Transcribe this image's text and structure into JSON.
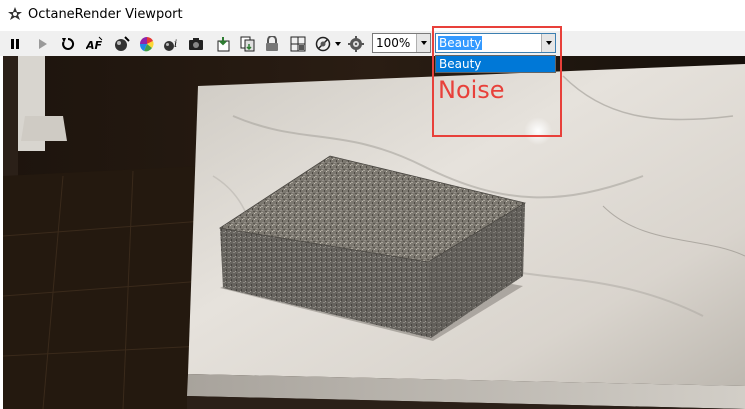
{
  "window": {
    "title": "OctaneRender Viewport"
  },
  "toolbar": {
    "buttons": [
      {
        "name": "pause-button",
        "icon": "pause-icon"
      },
      {
        "name": "play-button",
        "icon": "play-icon"
      },
      {
        "name": "restart-button",
        "icon": "restart-icon"
      },
      {
        "name": "auto-focus-button",
        "icon": "af-icon"
      },
      {
        "name": "pick-material-button",
        "icon": "material-pick-icon"
      },
      {
        "name": "color-picker-button",
        "icon": "color-wheel-icon"
      },
      {
        "name": "info-button",
        "icon": "info-icon"
      },
      {
        "name": "camera-button",
        "icon": "camera-icon"
      },
      {
        "name": "save-render-button",
        "icon": "save-icon"
      },
      {
        "name": "copy-render-button",
        "icon": "copy-icon"
      },
      {
        "name": "lock-button",
        "icon": "lock-icon"
      },
      {
        "name": "region-button",
        "icon": "region-icon"
      },
      {
        "name": "clay-mode-button",
        "icon": "clay-icon"
      },
      {
        "name": "settings-button",
        "icon": "gear-icon"
      }
    ],
    "zoom": {
      "value": "100%"
    },
    "render_pass": {
      "selected": "Beauty",
      "options": [
        "Beauty"
      ]
    }
  },
  "annotation": {
    "label": "Noise",
    "color": "#e8403a"
  },
  "colors": {
    "selection": "#3399ff",
    "dropdown_highlight": "#0078d7"
  }
}
